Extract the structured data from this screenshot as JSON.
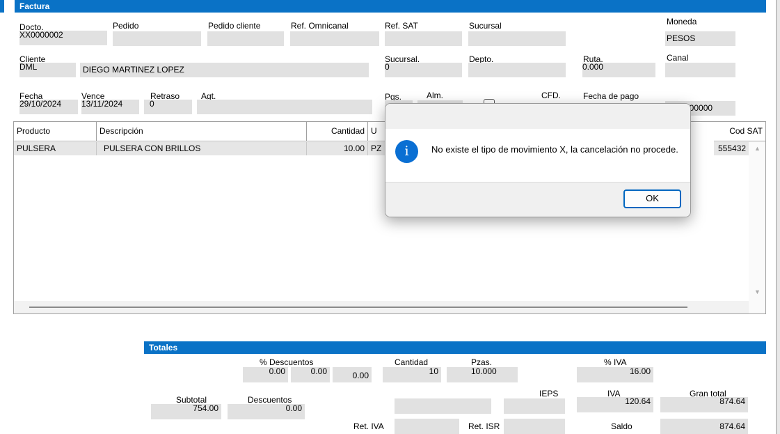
{
  "factura": {
    "section_title": "Factura",
    "docto_label": "Docto.",
    "docto_value": "XX0000002",
    "pedido_label": "Pedido",
    "pedido_value": "",
    "pedido_cliente_label": "Pedido cliente",
    "pedido_cliente_value": "",
    "ref_omnicanal_label": "Ref. Omnicanal",
    "ref_omnicanal_value": "",
    "ref_sat_label": "Ref. SAT",
    "ref_sat_value": "",
    "sucursal_label": "Sucursal",
    "sucursal_value": "",
    "moneda_label": "Moneda",
    "moneda_value": "PESOS",
    "cliente_label": "Cliente",
    "cliente_code": "DML",
    "cliente_name": "DIEGO MARTINEZ LOPEZ",
    "sucursal2_label": "Sucursal.",
    "sucursal2_value": "0",
    "depto_label": "Depto.",
    "depto_value": "",
    "ruta_label": "Ruta.",
    "ruta_value": "0.000",
    "canal_label": "Canal",
    "canal_value": "",
    "fecha_label": "Fecha",
    "fecha_value": "29/10/2024",
    "vence_label": "Vence",
    "vence_value": "13/11/2024",
    "retraso_label": "Retraso",
    "retraso_value": "0",
    "agt_label": "Agt.",
    "agt_value": "",
    "pgs_label": "Pgs.",
    "alm_label": "Alm.",
    "cfd_label": "CFD.",
    "fecha_pago_label": "Fecha de pago",
    "fecha_pago_partial": "000000"
  },
  "grid": {
    "headers": [
      "Producto",
      "Descripción",
      "Cantidad",
      "U",
      "Cod SAT"
    ],
    "row": {
      "producto": "PULSERA",
      "descripcion": "PULSERA CON BRILLOS",
      "cantidad": "10.00",
      "unidad": "PZ",
      "cod_sat": "555432"
    }
  },
  "dialog": {
    "message": "No existe el tipo de movimiento X, la cancelación no procede.",
    "ok_label": "OK",
    "icon": "info-icon"
  },
  "totales": {
    "section_title": "Totales",
    "pct_descuentos_label": "% Descuentos",
    "desc1": "0.00",
    "desc2": "0.00",
    "desc3": "0.00",
    "cantidad_label": "Cantidad",
    "cantidad_value": "10",
    "pzas_label": "Pzas.",
    "pzas_value": "10.000",
    "pct_iva_label": "% IVA",
    "pct_iva_value": "16.00",
    "subtotal_label": "Subtotal",
    "subtotal_value": "754.00",
    "descuentos_label": "Descuentos",
    "descuentos_value": "0.00",
    "ieps_label": "IEPS",
    "ieps_value": "",
    "iva_label": "IVA",
    "iva_value": "120.64",
    "gran_total_label": "Gran total",
    "gran_total_value": "874.64",
    "ret_iva_label": "Ret. IVA",
    "ret_iva_value": "",
    "ret_isr_label": "Ret. ISR",
    "ret_isr_value": "",
    "saldo_label": "Saldo",
    "saldo_value": "874.64"
  },
  "colors": {
    "header_blue": "#0a72c6",
    "field_gray": "#e1e1e1",
    "ok_border": "#0067c0"
  }
}
